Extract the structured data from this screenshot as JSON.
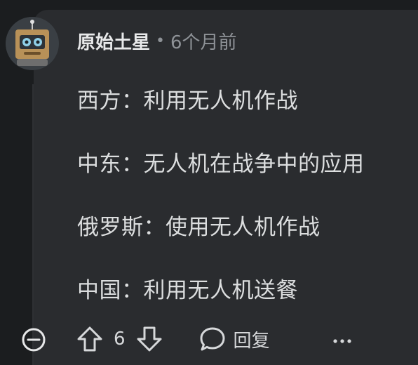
{
  "comment": {
    "username": "原始土星",
    "separator": "•",
    "timestamp": "6个月前",
    "lines": [
      "西方：利用无人机作战",
      "中东：无人机在战争中的应用",
      "俄罗斯：使用无人机作战",
      "中国：利用无人机送餐"
    ]
  },
  "actions": {
    "vote_count": "6",
    "reply_label": "回复"
  },
  "colors": {
    "background": "#1b1d1f",
    "card": "#2a2c2f",
    "text": "#dcdedf",
    "muted": "#8e9297"
  }
}
